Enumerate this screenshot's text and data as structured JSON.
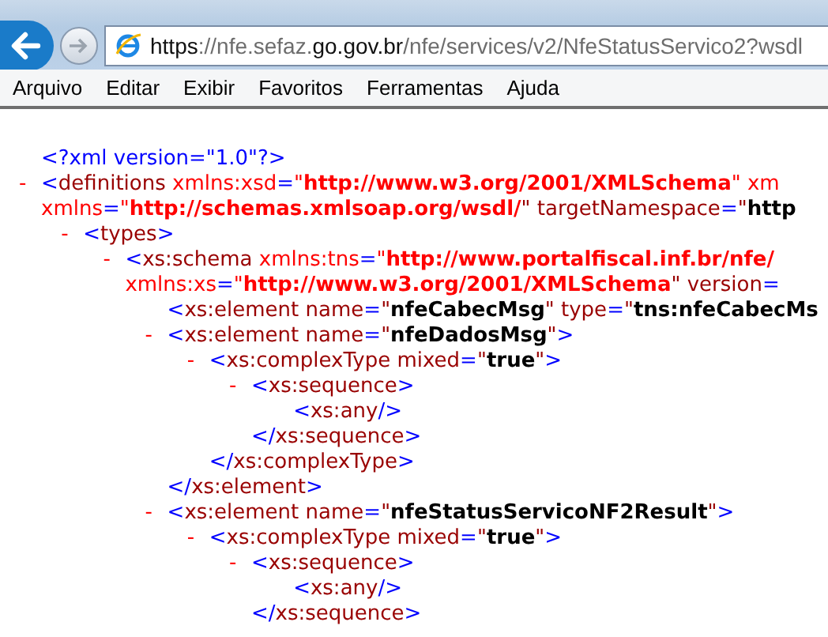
{
  "address_bar": {
    "url": [
      {
        "text": "https",
        "strong": true
      },
      {
        "text": "://nfe.sefaz.",
        "strong": false
      },
      {
        "text": "go.gov.br",
        "strong": true
      },
      {
        "text": "/nfe/services/v2/NfeStatusServico2?wsdl",
        "strong": false
      }
    ]
  },
  "menu": [
    "Arquivo",
    "Editar",
    "Exibir",
    "Favoritos",
    "Ferramentas",
    "Ajuda"
  ],
  "xml_tree": [
    {
      "open": [
        [
          {
            "kind": "p",
            "t": "<?xml version=\"1.0\"?>"
          }
        ]
      ]
    },
    {
      "toggle": "-",
      "open": [
        [
          {
            "kind": "p",
            "t": "<"
          },
          {
            "kind": "t",
            "t": "definitions "
          },
          {
            "kind": "na",
            "t": "xmlns:xsd"
          },
          {
            "kind": "p",
            "t": "="
          },
          {
            "kind": "na",
            "t": "\""
          },
          {
            "kind": "nv",
            "t": "http://www.w3.org/2001/XMLSchema"
          },
          {
            "kind": "na",
            "t": "\" xm"
          }
        ],
        [
          {
            "kind": "na",
            "t": "xmlns"
          },
          {
            "kind": "p",
            "t": "="
          },
          {
            "kind": "na",
            "t": "\""
          },
          {
            "kind": "nv",
            "t": "http://schemas.xmlsoap.org/wsdl/"
          },
          {
            "kind": "a",
            "t": "\" targetNamespace"
          },
          {
            "kind": "p",
            "t": "="
          },
          {
            "kind": "a",
            "t": "\""
          },
          {
            "kind": "v",
            "t": "http"
          }
        ]
      ],
      "children": [
        {
          "toggle": "-",
          "open": [
            [
              {
                "kind": "p",
                "t": "<"
              },
              {
                "kind": "t",
                "t": "types"
              },
              {
                "kind": "p",
                "t": ">"
              }
            ]
          ],
          "children": [
            {
              "toggle": "-",
              "open": [
                [
                  {
                    "kind": "p",
                    "t": "<"
                  },
                  {
                    "kind": "t",
                    "t": "xs:schema "
                  },
                  {
                    "kind": "na",
                    "t": "xmlns:tns"
                  },
                  {
                    "kind": "p",
                    "t": "="
                  },
                  {
                    "kind": "na",
                    "t": "\""
                  },
                  {
                    "kind": "nv",
                    "t": "http://www.portalfiscal.inf.br/nfe/"
                  }
                ],
                [
                  {
                    "kind": "na",
                    "t": "xmlns:xs"
                  },
                  {
                    "kind": "p",
                    "t": "="
                  },
                  {
                    "kind": "na",
                    "t": "\""
                  },
                  {
                    "kind": "nv",
                    "t": "http://www.w3.org/2001/XMLSchema"
                  },
                  {
                    "kind": "a",
                    "t": "\" version"
                  },
                  {
                    "kind": "p",
                    "t": "="
                  }
                ]
              ],
              "children": [
                {
                  "open": [
                    [
                      {
                        "kind": "p",
                        "t": "<"
                      },
                      {
                        "kind": "t",
                        "t": "xs:element "
                      },
                      {
                        "kind": "a",
                        "t": "name"
                      },
                      {
                        "kind": "p",
                        "t": "="
                      },
                      {
                        "kind": "a",
                        "t": "\""
                      },
                      {
                        "kind": "v",
                        "t": "nfeCabecMsg"
                      },
                      {
                        "kind": "a",
                        "t": "\" type"
                      },
                      {
                        "kind": "p",
                        "t": "="
                      },
                      {
                        "kind": "a",
                        "t": "\""
                      },
                      {
                        "kind": "v",
                        "t": "tns:nfeCabecMs"
                      }
                    ]
                  ]
                },
                {
                  "toggle": "-",
                  "open": [
                    [
                      {
                        "kind": "p",
                        "t": "<"
                      },
                      {
                        "kind": "t",
                        "t": "xs:element "
                      },
                      {
                        "kind": "a",
                        "t": "name"
                      },
                      {
                        "kind": "p",
                        "t": "="
                      },
                      {
                        "kind": "a",
                        "t": "\""
                      },
                      {
                        "kind": "v",
                        "t": "nfeDadosMsg"
                      },
                      {
                        "kind": "a",
                        "t": "\""
                      },
                      {
                        "kind": "p",
                        "t": ">"
                      }
                    ]
                  ],
                  "children": [
                    {
                      "toggle": "-",
                      "open": [
                        [
                          {
                            "kind": "p",
                            "t": "<"
                          },
                          {
                            "kind": "t",
                            "t": "xs:complexType "
                          },
                          {
                            "kind": "a",
                            "t": "mixed"
                          },
                          {
                            "kind": "p",
                            "t": "="
                          },
                          {
                            "kind": "a",
                            "t": "\""
                          },
                          {
                            "kind": "v",
                            "t": "true"
                          },
                          {
                            "kind": "a",
                            "t": "\""
                          },
                          {
                            "kind": "p",
                            "t": ">"
                          }
                        ]
                      ],
                      "children": [
                        {
                          "toggle": "-",
                          "open": [
                            [
                              {
                                "kind": "p",
                                "t": "<"
                              },
                              {
                                "kind": "t",
                                "t": "xs:sequence"
                              },
                              {
                                "kind": "p",
                                "t": ">"
                              }
                            ]
                          ],
                          "children": [
                            {
                              "open": [
                                [
                                  {
                                    "kind": "p",
                                    "t": "<"
                                  },
                                  {
                                    "kind": "t",
                                    "t": "xs:any"
                                  },
                                  {
                                    "kind": "p",
                                    "t": "/>"
                                  }
                                ]
                              ]
                            }
                          ],
                          "close": [
                            {
                              "kind": "p",
                              "t": "</"
                            },
                            {
                              "kind": "t",
                              "t": "xs:sequence"
                            },
                            {
                              "kind": "p",
                              "t": ">"
                            }
                          ]
                        }
                      ],
                      "close": [
                        {
                          "kind": "p",
                          "t": "</"
                        },
                        {
                          "kind": "t",
                          "t": "xs:complexType"
                        },
                        {
                          "kind": "p",
                          "t": ">"
                        }
                      ]
                    }
                  ],
                  "close": [
                    {
                      "kind": "p",
                      "t": "</"
                    },
                    {
                      "kind": "t",
                      "t": "xs:element"
                    },
                    {
                      "kind": "p",
                      "t": ">"
                    }
                  ]
                },
                {
                  "toggle": "-",
                  "open": [
                    [
                      {
                        "kind": "p",
                        "t": "<"
                      },
                      {
                        "kind": "t",
                        "t": "xs:element "
                      },
                      {
                        "kind": "a",
                        "t": "name"
                      },
                      {
                        "kind": "p",
                        "t": "="
                      },
                      {
                        "kind": "a",
                        "t": "\""
                      },
                      {
                        "kind": "v",
                        "t": "nfeStatusServicoNF2Result"
                      },
                      {
                        "kind": "a",
                        "t": "\""
                      },
                      {
                        "kind": "p",
                        "t": ">"
                      }
                    ]
                  ],
                  "children": [
                    {
                      "toggle": "-",
                      "open": [
                        [
                          {
                            "kind": "p",
                            "t": "<"
                          },
                          {
                            "kind": "t",
                            "t": "xs:complexType "
                          },
                          {
                            "kind": "a",
                            "t": "mixed"
                          },
                          {
                            "kind": "p",
                            "t": "="
                          },
                          {
                            "kind": "a",
                            "t": "\""
                          },
                          {
                            "kind": "v",
                            "t": "true"
                          },
                          {
                            "kind": "a",
                            "t": "\""
                          },
                          {
                            "kind": "p",
                            "t": ">"
                          }
                        ]
                      ],
                      "children": [
                        {
                          "toggle": "-",
                          "open": [
                            [
                              {
                                "kind": "p",
                                "t": "<"
                              },
                              {
                                "kind": "t",
                                "t": "xs:sequence"
                              },
                              {
                                "kind": "p",
                                "t": ">"
                              }
                            ]
                          ],
                          "children": [
                            {
                              "open": [
                                [
                                  {
                                    "kind": "p",
                                    "t": "<"
                                  },
                                  {
                                    "kind": "t",
                                    "t": "xs:any"
                                  },
                                  {
                                    "kind": "p",
                                    "t": "/>"
                                  }
                                ]
                              ]
                            }
                          ],
                          "close": [
                            {
                              "kind": "p",
                              "t": "</"
                            },
                            {
                              "kind": "t",
                              "t": "xs:sequence"
                            },
                            {
                              "kind": "p",
                              "t": ">"
                            }
                          ]
                        }
                      ]
                    }
                  ]
                }
              ]
            }
          ]
        }
      ]
    }
  ]
}
